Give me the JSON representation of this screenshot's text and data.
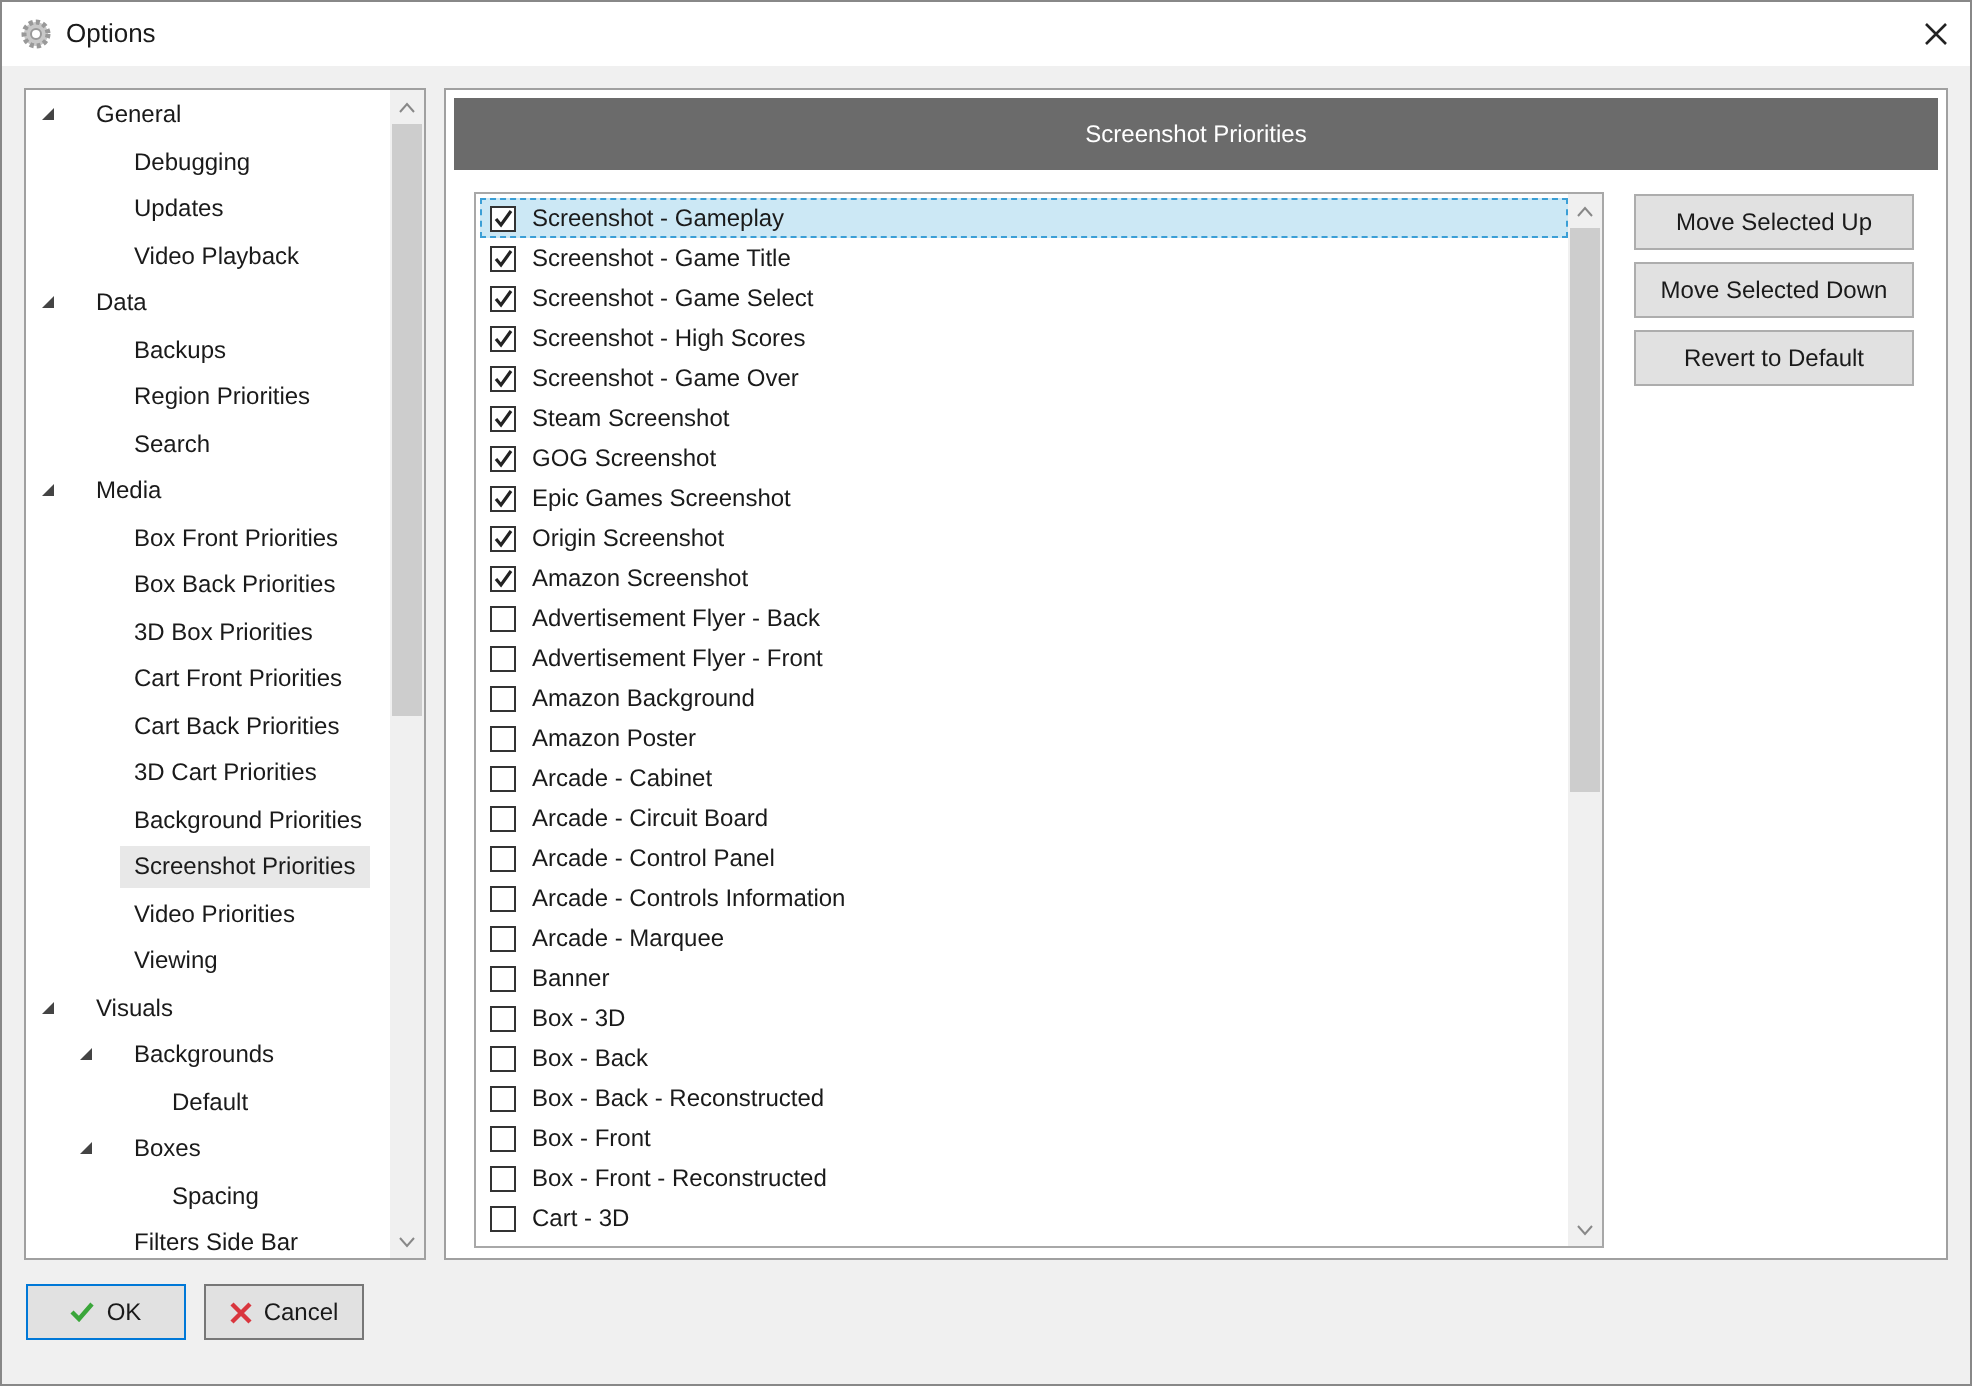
{
  "window": {
    "title": "Options"
  },
  "tree": [
    {
      "label": "General",
      "expanded": true,
      "selected": false,
      "children": [
        {
          "label": "Debugging",
          "selected": false
        },
        {
          "label": "Updates",
          "selected": false
        },
        {
          "label": "Video Playback",
          "selected": false
        }
      ]
    },
    {
      "label": "Data",
      "expanded": true,
      "selected": false,
      "children": [
        {
          "label": "Backups",
          "selected": false
        },
        {
          "label": "Region Priorities",
          "selected": false
        },
        {
          "label": "Search",
          "selected": false
        }
      ]
    },
    {
      "label": "Media",
      "expanded": true,
      "selected": false,
      "children": [
        {
          "label": "Box Front Priorities",
          "selected": false
        },
        {
          "label": "Box Back Priorities",
          "selected": false
        },
        {
          "label": "3D Box Priorities",
          "selected": false
        },
        {
          "label": "Cart Front Priorities",
          "selected": false
        },
        {
          "label": "Cart Back Priorities",
          "selected": false
        },
        {
          "label": "3D Cart Priorities",
          "selected": false
        },
        {
          "label": "Background Priorities",
          "selected": false
        },
        {
          "label": "Screenshot Priorities",
          "selected": true
        },
        {
          "label": "Video Priorities",
          "selected": false
        },
        {
          "label": "Viewing",
          "selected": false
        }
      ]
    },
    {
      "label": "Visuals",
      "expanded": true,
      "selected": false,
      "children": [
        {
          "label": "Backgrounds",
          "expanded": true,
          "selected": false,
          "children": [
            {
              "label": "Default",
              "selected": false
            }
          ]
        },
        {
          "label": "Boxes",
          "expanded": true,
          "selected": false,
          "children": [
            {
              "label": "Spacing",
              "selected": false
            }
          ]
        },
        {
          "label": "Filters Side Bar",
          "selected": false
        }
      ]
    }
  ],
  "panel": {
    "title": "Screenshot Priorities"
  },
  "priorities": [
    {
      "label": "Screenshot - Gameplay",
      "checked": true,
      "selected": true
    },
    {
      "label": "Screenshot - Game Title",
      "checked": true,
      "selected": false
    },
    {
      "label": "Screenshot - Game Select",
      "checked": true,
      "selected": false
    },
    {
      "label": "Screenshot - High Scores",
      "checked": true,
      "selected": false
    },
    {
      "label": "Screenshot - Game Over",
      "checked": true,
      "selected": false
    },
    {
      "label": "Steam Screenshot",
      "checked": true,
      "selected": false
    },
    {
      "label": "GOG Screenshot",
      "checked": true,
      "selected": false
    },
    {
      "label": "Epic Games Screenshot",
      "checked": true,
      "selected": false
    },
    {
      "label": "Origin Screenshot",
      "checked": true,
      "selected": false
    },
    {
      "label": "Amazon Screenshot",
      "checked": true,
      "selected": false
    },
    {
      "label": "Advertisement Flyer - Back",
      "checked": false,
      "selected": false
    },
    {
      "label": "Advertisement Flyer - Front",
      "checked": false,
      "selected": false
    },
    {
      "label": "Amazon Background",
      "checked": false,
      "selected": false
    },
    {
      "label": "Amazon Poster",
      "checked": false,
      "selected": false
    },
    {
      "label": "Arcade - Cabinet",
      "checked": false,
      "selected": false
    },
    {
      "label": "Arcade - Circuit Board",
      "checked": false,
      "selected": false
    },
    {
      "label": "Arcade - Control Panel",
      "checked": false,
      "selected": false
    },
    {
      "label": "Arcade - Controls Information",
      "checked": false,
      "selected": false
    },
    {
      "label": "Arcade - Marquee",
      "checked": false,
      "selected": false
    },
    {
      "label": "Banner",
      "checked": false,
      "selected": false
    },
    {
      "label": "Box - 3D",
      "checked": false,
      "selected": false
    },
    {
      "label": "Box - Back",
      "checked": false,
      "selected": false
    },
    {
      "label": "Box - Back - Reconstructed",
      "checked": false,
      "selected": false
    },
    {
      "label": "Box - Front",
      "checked": false,
      "selected": false
    },
    {
      "label": "Box - Front - Reconstructed",
      "checked": false,
      "selected": false
    },
    {
      "label": "Cart - 3D",
      "checked": false,
      "selected": false
    }
  ],
  "side_buttons": [
    "Move Selected Up",
    "Move Selected Down",
    "Revert to Default"
  ],
  "footer": {
    "ok": "OK",
    "cancel": "Cancel"
  }
}
